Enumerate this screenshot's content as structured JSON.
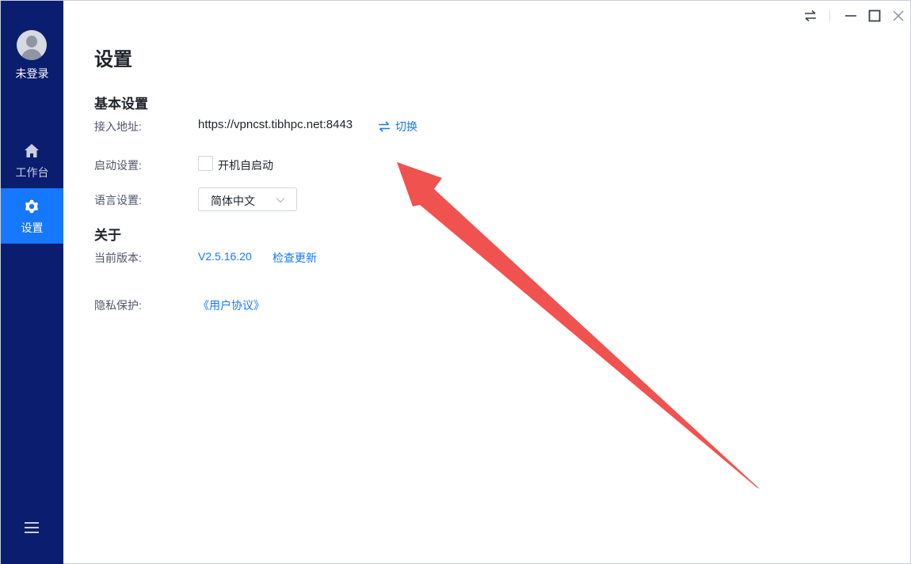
{
  "sidebar": {
    "user_name": "未登录",
    "items": [
      {
        "label": "工作台",
        "icon": "home-icon"
      },
      {
        "label": "设置",
        "icon": "gear-icon"
      }
    ],
    "menu_icon": "hamburger-menu-icon",
    "background": "#0b1d6e",
    "active_color": "#1677ff"
  },
  "titlebar": {
    "controls": [
      "switch-icon",
      "minimize-icon",
      "maximize-icon",
      "close-icon"
    ]
  },
  "main": {
    "title": "设置",
    "basic_section": {
      "title": "基本设置",
      "address_label": "接入地址:",
      "address_value": "https://vpncst.tibhpc.net:8443",
      "switch_label": "切换",
      "startup_label": "启动设置:",
      "startup_option": "开机自启动",
      "startup_checked": false,
      "language_label": "语言设置:",
      "language_value": "简体中文"
    },
    "about_section": {
      "title": "关于",
      "version_label": "当前版本:",
      "version_value": "V2.5.16.20",
      "check_update": "检查更新",
      "privacy_label": "隐私保护:",
      "agreement_link": "《用户协议》"
    }
  },
  "colors": {
    "link": "#1677ff",
    "annotation_arrow": "#f0524f"
  }
}
